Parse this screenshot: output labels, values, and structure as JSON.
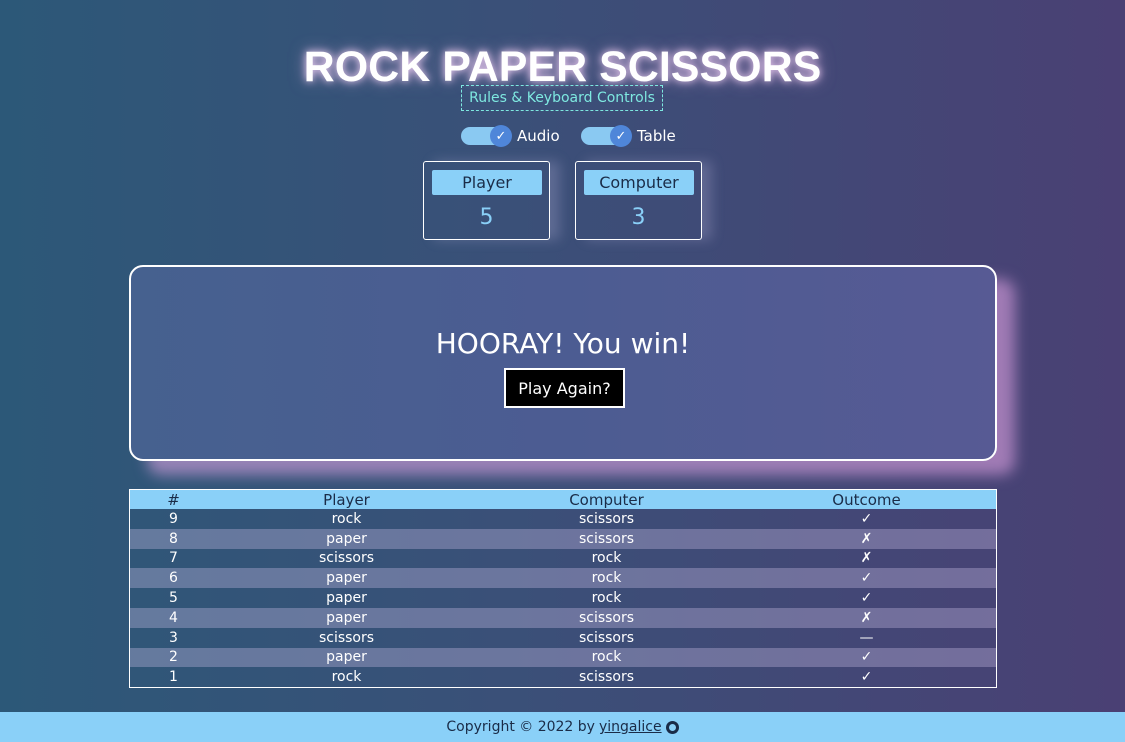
{
  "title": "ROCK PAPER SCISSORS",
  "rules_link": "Rules & Keyboard Controls",
  "toggles": [
    {
      "label": "Audio",
      "checked": true,
      "check_glyph": "✓"
    },
    {
      "label": "Table",
      "checked": true,
      "check_glyph": "✓"
    }
  ],
  "scores": {
    "player_label": "Player",
    "player_value": "5",
    "computer_label": "Computer",
    "computer_value": "3"
  },
  "result": {
    "message": "HOORAY! You win!",
    "play_again_label": "Play Again?"
  },
  "history": {
    "headers": [
      "#",
      "Player",
      "Computer",
      "Outcome"
    ],
    "rows": [
      {
        "num": "9",
        "player": "rock",
        "computer": "scissors",
        "outcome": "✓",
        "result": "win"
      },
      {
        "num": "8",
        "player": "paper",
        "computer": "scissors",
        "outcome": "✗",
        "result": "lose"
      },
      {
        "num": "7",
        "player": "scissors",
        "computer": "rock",
        "outcome": "✗",
        "result": "lose"
      },
      {
        "num": "6",
        "player": "paper",
        "computer": "rock",
        "outcome": "✓",
        "result": "win"
      },
      {
        "num": "5",
        "player": "paper",
        "computer": "rock",
        "outcome": "✓",
        "result": "win"
      },
      {
        "num": "4",
        "player": "paper",
        "computer": "scissors",
        "outcome": "✗",
        "result": "lose"
      },
      {
        "num": "3",
        "player": "scissors",
        "computer": "scissors",
        "outcome": "—",
        "result": "tie"
      },
      {
        "num": "2",
        "player": "paper",
        "computer": "rock",
        "outcome": "✓",
        "result": "win"
      },
      {
        "num": "1",
        "player": "rock",
        "computer": "scissors",
        "outcome": "✓",
        "result": "win"
      }
    ]
  },
  "footer": {
    "text": "Copyright © 2022 by",
    "link": "yingalice",
    "icon": "github-icon"
  },
  "colors": {
    "accent": "#8ad0f8",
    "link_dashed": "#7ee8e0",
    "win": "#3fe07a",
    "lose": "#e8324a"
  }
}
